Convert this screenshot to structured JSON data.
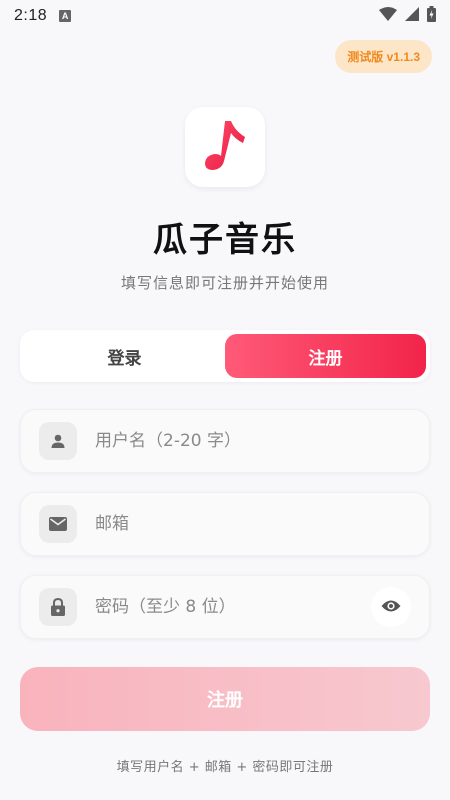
{
  "status_bar": {
    "time": "2:18",
    "notification_icon": "A"
  },
  "version_badge": "测试版 v1.1.3",
  "app": {
    "title": "瓜子音乐",
    "subtitle": "填写信息即可注册并开始使用",
    "logo_icon": "music-note-icon",
    "accent_color": "#f2244a"
  },
  "tabs": [
    {
      "label": "登录",
      "active": false
    },
    {
      "label": "注册",
      "active": true
    }
  ],
  "form": {
    "username_placeholder": "用户名（2-20 字）",
    "email_placeholder": "邮箱",
    "password_placeholder": "密码（至少 8 位）",
    "submit_label": "注册"
  },
  "footer_hint": "填写用户名 + 邮箱 + 密码即可注册"
}
